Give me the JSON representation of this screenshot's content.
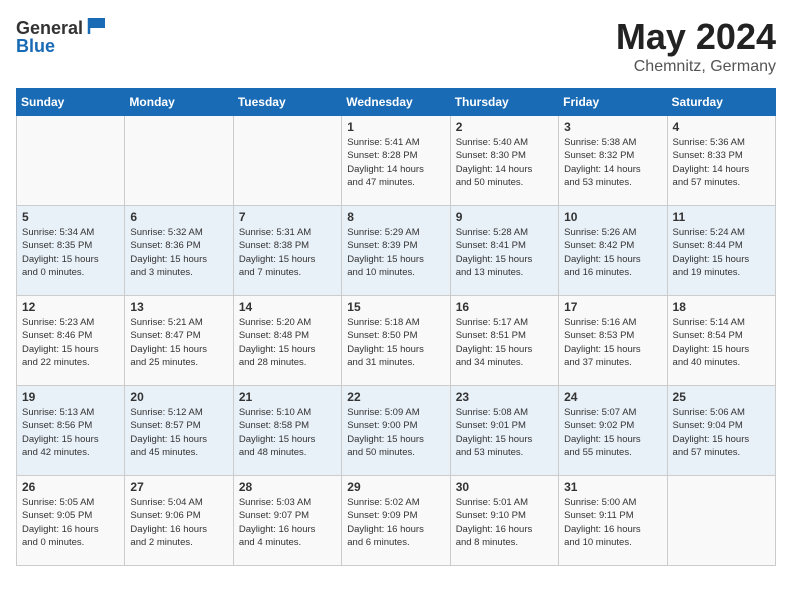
{
  "header": {
    "logo_general": "General",
    "logo_blue": "Blue",
    "title": "May 2024",
    "location": "Chemnitz, Germany"
  },
  "weekdays": [
    "Sunday",
    "Monday",
    "Tuesday",
    "Wednesday",
    "Thursday",
    "Friday",
    "Saturday"
  ],
  "weeks": [
    [
      {
        "day": "",
        "info": ""
      },
      {
        "day": "",
        "info": ""
      },
      {
        "day": "",
        "info": ""
      },
      {
        "day": "1",
        "info": "Sunrise: 5:41 AM\nSunset: 8:28 PM\nDaylight: 14 hours\nand 47 minutes."
      },
      {
        "day": "2",
        "info": "Sunrise: 5:40 AM\nSunset: 8:30 PM\nDaylight: 14 hours\nand 50 minutes."
      },
      {
        "day": "3",
        "info": "Sunrise: 5:38 AM\nSunset: 8:32 PM\nDaylight: 14 hours\nand 53 minutes."
      },
      {
        "day": "4",
        "info": "Sunrise: 5:36 AM\nSunset: 8:33 PM\nDaylight: 14 hours\nand 57 minutes."
      }
    ],
    [
      {
        "day": "5",
        "info": "Sunrise: 5:34 AM\nSunset: 8:35 PM\nDaylight: 15 hours\nand 0 minutes."
      },
      {
        "day": "6",
        "info": "Sunrise: 5:32 AM\nSunset: 8:36 PM\nDaylight: 15 hours\nand 3 minutes."
      },
      {
        "day": "7",
        "info": "Sunrise: 5:31 AM\nSunset: 8:38 PM\nDaylight: 15 hours\nand 7 minutes."
      },
      {
        "day": "8",
        "info": "Sunrise: 5:29 AM\nSunset: 8:39 PM\nDaylight: 15 hours\nand 10 minutes."
      },
      {
        "day": "9",
        "info": "Sunrise: 5:28 AM\nSunset: 8:41 PM\nDaylight: 15 hours\nand 13 minutes."
      },
      {
        "day": "10",
        "info": "Sunrise: 5:26 AM\nSunset: 8:42 PM\nDaylight: 15 hours\nand 16 minutes."
      },
      {
        "day": "11",
        "info": "Sunrise: 5:24 AM\nSunset: 8:44 PM\nDaylight: 15 hours\nand 19 minutes."
      }
    ],
    [
      {
        "day": "12",
        "info": "Sunrise: 5:23 AM\nSunset: 8:46 PM\nDaylight: 15 hours\nand 22 minutes."
      },
      {
        "day": "13",
        "info": "Sunrise: 5:21 AM\nSunset: 8:47 PM\nDaylight: 15 hours\nand 25 minutes."
      },
      {
        "day": "14",
        "info": "Sunrise: 5:20 AM\nSunset: 8:48 PM\nDaylight: 15 hours\nand 28 minutes."
      },
      {
        "day": "15",
        "info": "Sunrise: 5:18 AM\nSunset: 8:50 PM\nDaylight: 15 hours\nand 31 minutes."
      },
      {
        "day": "16",
        "info": "Sunrise: 5:17 AM\nSunset: 8:51 PM\nDaylight: 15 hours\nand 34 minutes."
      },
      {
        "day": "17",
        "info": "Sunrise: 5:16 AM\nSunset: 8:53 PM\nDaylight: 15 hours\nand 37 minutes."
      },
      {
        "day": "18",
        "info": "Sunrise: 5:14 AM\nSunset: 8:54 PM\nDaylight: 15 hours\nand 40 minutes."
      }
    ],
    [
      {
        "day": "19",
        "info": "Sunrise: 5:13 AM\nSunset: 8:56 PM\nDaylight: 15 hours\nand 42 minutes."
      },
      {
        "day": "20",
        "info": "Sunrise: 5:12 AM\nSunset: 8:57 PM\nDaylight: 15 hours\nand 45 minutes."
      },
      {
        "day": "21",
        "info": "Sunrise: 5:10 AM\nSunset: 8:58 PM\nDaylight: 15 hours\nand 48 minutes."
      },
      {
        "day": "22",
        "info": "Sunrise: 5:09 AM\nSunset: 9:00 PM\nDaylight: 15 hours\nand 50 minutes."
      },
      {
        "day": "23",
        "info": "Sunrise: 5:08 AM\nSunset: 9:01 PM\nDaylight: 15 hours\nand 53 minutes."
      },
      {
        "day": "24",
        "info": "Sunrise: 5:07 AM\nSunset: 9:02 PM\nDaylight: 15 hours\nand 55 minutes."
      },
      {
        "day": "25",
        "info": "Sunrise: 5:06 AM\nSunset: 9:04 PM\nDaylight: 15 hours\nand 57 minutes."
      }
    ],
    [
      {
        "day": "26",
        "info": "Sunrise: 5:05 AM\nSunset: 9:05 PM\nDaylight: 16 hours\nand 0 minutes."
      },
      {
        "day": "27",
        "info": "Sunrise: 5:04 AM\nSunset: 9:06 PM\nDaylight: 16 hours\nand 2 minutes."
      },
      {
        "day": "28",
        "info": "Sunrise: 5:03 AM\nSunset: 9:07 PM\nDaylight: 16 hours\nand 4 minutes."
      },
      {
        "day": "29",
        "info": "Sunrise: 5:02 AM\nSunset: 9:09 PM\nDaylight: 16 hours\nand 6 minutes."
      },
      {
        "day": "30",
        "info": "Sunrise: 5:01 AM\nSunset: 9:10 PM\nDaylight: 16 hours\nand 8 minutes."
      },
      {
        "day": "31",
        "info": "Sunrise: 5:00 AM\nSunset: 9:11 PM\nDaylight: 16 hours\nand 10 minutes."
      },
      {
        "day": "",
        "info": ""
      }
    ]
  ]
}
